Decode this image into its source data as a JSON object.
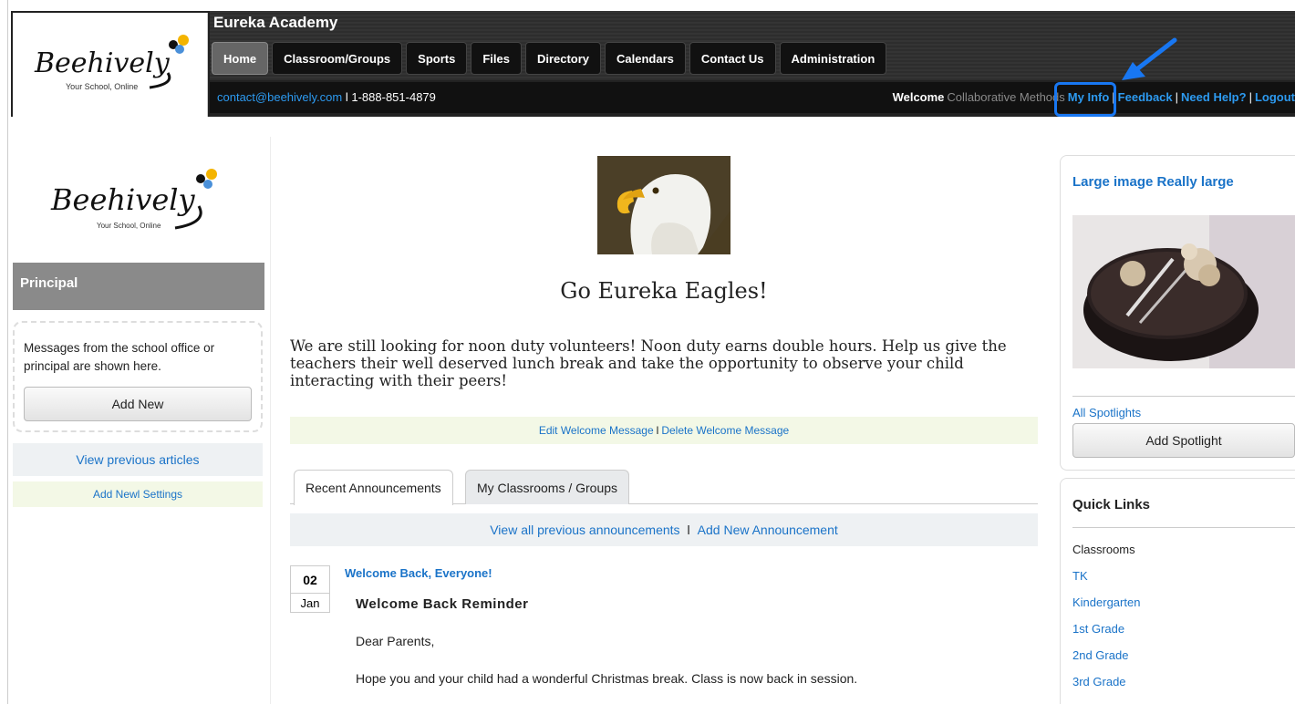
{
  "header": {
    "school_name": "Eureka Academy",
    "logo_text": "Beehively",
    "logo_tagline": "Your School, Online",
    "nav": [
      "Home",
      "Classroom/Groups",
      "Sports",
      "Files",
      "Directory",
      "Calendars",
      "Contact Us",
      "Administration"
    ],
    "contact_email": "contact@beehively.com",
    "contact_phone": " l 1-888-851-4879",
    "welcome_label": "Welcome",
    "user_name": "Collaborative Methods",
    "my_info": "My Info",
    "feedback": "Feedback",
    "need_help": "Need Help?",
    "logout": "Logout",
    "sep": "|"
  },
  "left": {
    "logo_text": "Beehively",
    "logo_tagline": "Your School, Online",
    "section_title": "Principal",
    "message": "Messages from the school office or principal are shown here.",
    "add_new": "Add New",
    "view_previous": "View previous articles",
    "add_settings": "Add Newl Settings"
  },
  "center": {
    "welcome_title": "Go Eureka Eagles!",
    "welcome_body": "We are still looking for noon duty volunteers! Noon duty earns double hours. Help us give the teachers their well deserved lunch break and take the opportunity to observe your child interacting with their peers!",
    "edit_welcome": "Edit Welcome Message",
    "delete_welcome": "Delete Welcome Message",
    "sep": "l",
    "tabs": [
      "Recent Announcements",
      "My Classrooms / Groups"
    ],
    "view_all": "View all previous announcements",
    "add_announcement": "Add New Announcement",
    "announcement": {
      "day": "02",
      "month": "Jan",
      "title": "Welcome Back, Everyone!",
      "heading": "Welcome Back Reminder",
      "p1": "Dear Parents,",
      "p2": "Hope you and your child had a wonderful Christmas break.  Class is now back in session."
    }
  },
  "right": {
    "spotlight_title": "Large image Really large",
    "all_spotlights": "All Spotlights",
    "add_spotlight": "Add Spotlight",
    "quick_links_title": "Quick Links",
    "quick_links": [
      {
        "label": "Classrooms",
        "link": false
      },
      {
        "label": "TK",
        "link": true
      },
      {
        "label": "Kindergarten",
        "link": true
      },
      {
        "label": "1st Grade",
        "link": true
      },
      {
        "label": "2nd Grade",
        "link": true
      },
      {
        "label": "3rd Grade",
        "link": true
      }
    ]
  },
  "colors": {
    "link": "#1a73c8",
    "highlight": "#1877f2",
    "header_bg": "#222222",
    "principal_bar": "#8a8a8a"
  }
}
